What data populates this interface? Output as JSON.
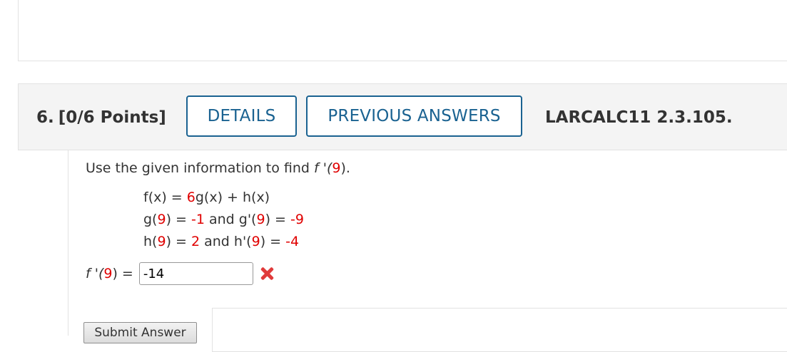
{
  "question": {
    "number": "6.",
    "points": "[0/6 Points]",
    "details_button": "DETAILS",
    "previous_answers_button": "PREVIOUS ANSWERS",
    "code": "LARCALC11 2.3.105."
  },
  "body": {
    "instruction_prefix": "Use the given information to find ",
    "instruction_func": "f '(",
    "instruction_arg": "9",
    "instruction_suffix": ").",
    "eq1": {
      "lhs": "f(x) = ",
      "coef": "6",
      "rhs": "g(x) + h(x)"
    },
    "eq2": {
      "p1": "g(",
      "a1": "9",
      "p2": ") = ",
      "v1": "-1",
      "p3": " and g'(",
      "a2": "9",
      "p4": ") = ",
      "v2": "-9"
    },
    "eq3": {
      "p1": "h(",
      "a1": "9",
      "p2": ") = ",
      "v1": "2",
      "p3": " and h'(",
      "a2": "9",
      "p4": ") = ",
      "v2": "-4"
    },
    "answer_label_prefix": "f '(",
    "answer_label_arg": "9",
    "answer_label_suffix": ") = ",
    "answer_value": "-14",
    "submit_label": "Submit Answer"
  },
  "icons": {
    "result": "incorrect-x-icon"
  },
  "colors": {
    "accent": "#1a6291",
    "highlight": "#e00000",
    "incorrect": "#e03a3a"
  }
}
